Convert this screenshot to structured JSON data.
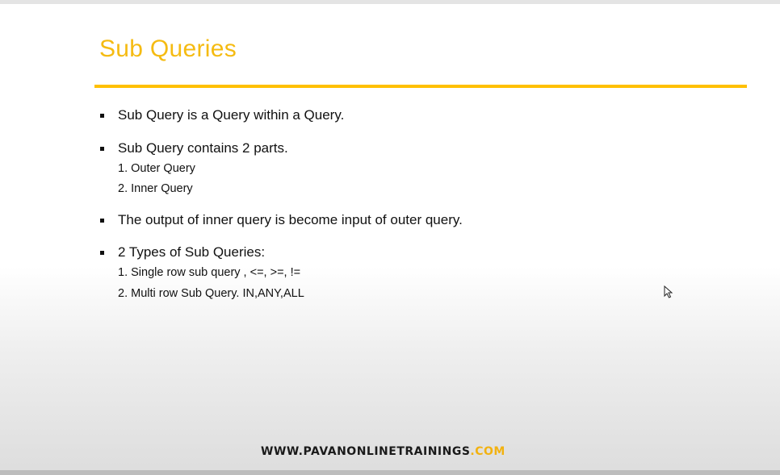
{
  "slide": {
    "title": "Sub Queries",
    "accent_color": "#FFC000",
    "bullets": [
      {
        "text": "Sub Query is a Query within a Query.",
        "subitems": []
      },
      {
        "text": "Sub Query contains 2 parts.",
        "subitems": [
          "1. Outer Query",
          "2. Inner Query"
        ]
      },
      {
        "text": "The output of inner query is become input of outer query.",
        "subitems": []
      },
      {
        "text": "2 Types of Sub Queries:",
        "subitems": [
          "1. Single row sub query , <=, >=, !=",
          "2. Multi row Sub Query. IN,ANY,ALL"
        ]
      }
    ],
    "footer": {
      "domain": "WWW.PAVANONLINETRAININGS",
      "tld": ".COM"
    }
  },
  "cursor": {
    "icon": "mouse-pointer-icon"
  }
}
